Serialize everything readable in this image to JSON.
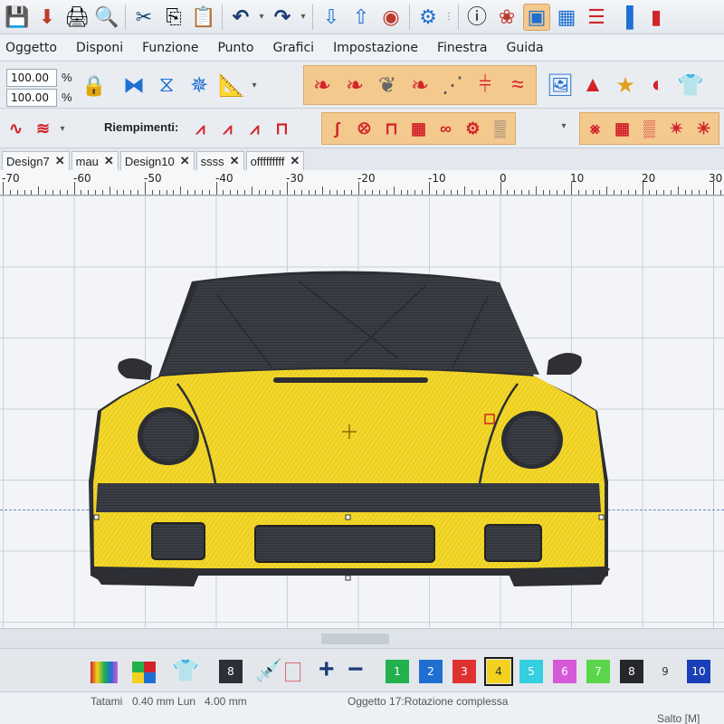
{
  "menu": [
    "Oggetto",
    "Disponi",
    "Funzione",
    "Punto",
    "Grafici",
    "Impostazione",
    "Finestra",
    "Guida"
  ],
  "scale": {
    "x_value": "100.00",
    "y_value": "100.00",
    "unit": "%"
  },
  "fills_label": "Riempimenti:",
  "tabs": [
    {
      "label": "Design7",
      "close": "✕"
    },
    {
      "label": "mau",
      "close": "✕"
    },
    {
      "label": "Design10",
      "close": "✕"
    },
    {
      "label": "ssss",
      "close": "✕"
    },
    {
      "label": "offfffffff",
      "close": "✕"
    }
  ],
  "ruler_labels": [
    "-70",
    "-60",
    "-50",
    "-40",
    "-30",
    "-20",
    "-10",
    "0",
    "10",
    "20",
    "30"
  ],
  "palette": [
    {
      "label": "8",
      "color": "#2b2f36"
    },
    {
      "label": "1",
      "color": "#22b14c"
    },
    {
      "label": "2",
      "color": "#1f6fd1"
    },
    {
      "label": "3",
      "color": "#e03131"
    },
    {
      "label": "4",
      "color": "#f2d21e"
    },
    {
      "label": "5",
      "color": "#34cfe0"
    },
    {
      "label": "6",
      "color": "#d65ad8"
    },
    {
      "label": "7",
      "color": "#5ad64a"
    },
    {
      "label": "8",
      "color": "#25272b"
    },
    {
      "label": "9",
      "color": "#e3e7ec"
    },
    {
      "label": "10",
      "color": "#1a3fb8"
    }
  ],
  "status": {
    "stitch": "Tatami",
    "length_info": "0.40 mm Lun",
    "length_value": "4.00 mm",
    "object": "Oggetto 17:Rotazione complessa",
    "hint": "Salto [M]"
  },
  "colors": {
    "car_yellow": "#f3d72a",
    "car_dark": "#3a3d44",
    "canvas": "#f2f4f7",
    "toolbar_accent": "#f3c98e"
  }
}
